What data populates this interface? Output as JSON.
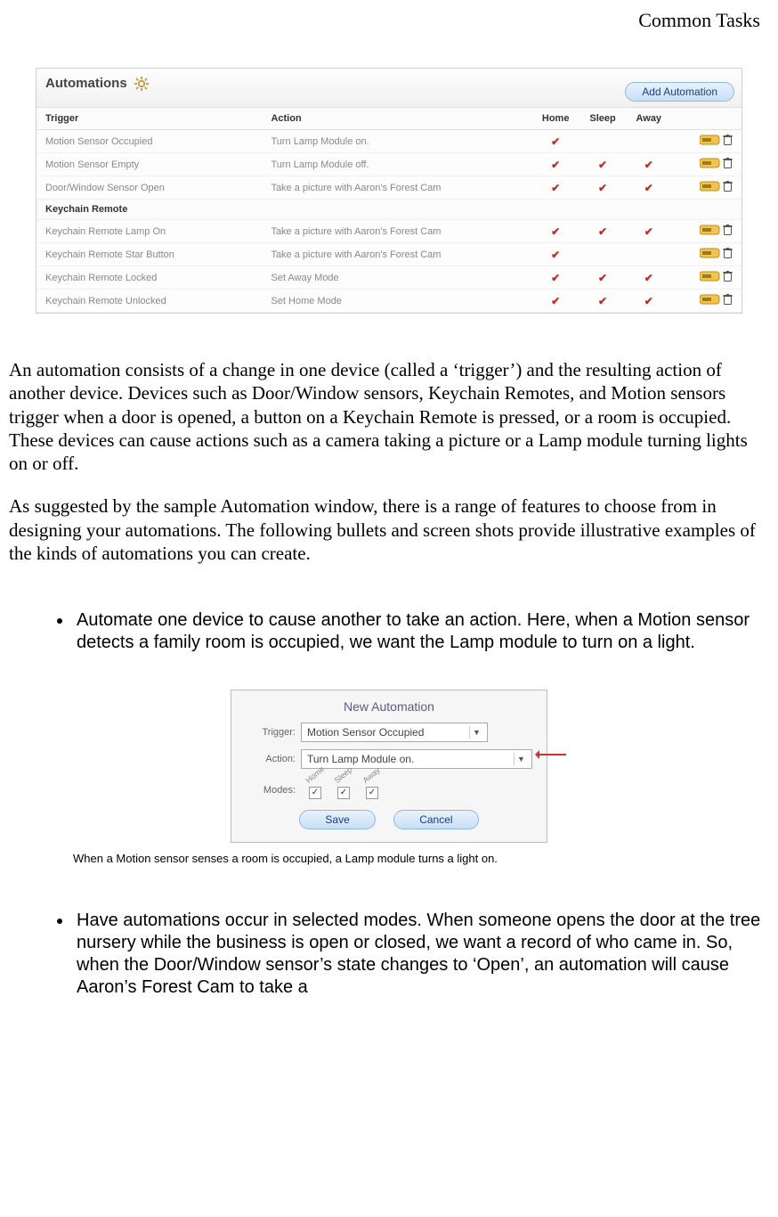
{
  "header": {
    "section_title": "Common Tasks"
  },
  "panel": {
    "title": "Automations",
    "add_button": "Add Automation",
    "columns": {
      "trigger": "Trigger",
      "action": "Action",
      "home": "Home",
      "sleep": "Sleep",
      "away": "Away"
    },
    "rows": [
      {
        "trigger": "Motion Sensor Occupied",
        "action": "Turn Lamp Module on.",
        "home": true,
        "sleep": false,
        "away": false
      },
      {
        "trigger": "Motion Sensor Empty",
        "action": "Turn Lamp Module off.",
        "home": true,
        "sleep": true,
        "away": true
      },
      {
        "trigger": "Door/Window Sensor Open",
        "action": "Take a picture with Aaron's Forest Cam",
        "home": true,
        "sleep": true,
        "away": true
      }
    ],
    "group_label": "Keychain Remote",
    "rows2": [
      {
        "trigger": "Keychain Remote Lamp On",
        "action": "Take a picture with Aaron's Forest Cam",
        "home": true,
        "sleep": true,
        "away": true
      },
      {
        "trigger": "Keychain Remote Star Button",
        "action": "Take a picture with Aaron's Forest Cam",
        "home": true,
        "sleep": false,
        "away": false
      },
      {
        "trigger": "Keychain Remote Locked",
        "action": "Set Away Mode",
        "home": true,
        "sleep": true,
        "away": true
      },
      {
        "trigger": "Keychain Remote Unlocked",
        "action": "Set Home Mode",
        "home": true,
        "sleep": true,
        "away": true
      }
    ]
  },
  "paragraphs": {
    "p1": "An automation consists of a change in one device (called a ‘trigger’) and the resulting action of another device. Devices such as Door/Window sensors, Keychain Remotes, and Motion sensors trigger when a door is opened, a button on a Keychain Remote is pressed, or a room is occupied. These devices can cause actions such as a camera taking a picture or a Lamp module turning lights on or off.",
    "p2": "As suggested by the sample Automation window, there is a range of features to choose from in designing your automations. The following bullets and screen shots provide illustrative examples of the kinds of automations you can create."
  },
  "bullets": {
    "b1": "Automate one device to cause another to take an action. Here, when a Motion sensor detects a family room is occupied, we want the Lamp module to turn on a light.",
    "b2": "Have automations occur in selected modes. When someone opens the door at the tree nursery while the business is open or closed, we want a record of who came in. So, when the Door/Window sensor’s state changes to ‘Open’, an automation will cause Aaron’s Forest Cam to take a"
  },
  "dialog": {
    "title": "New Automation",
    "labels": {
      "trigger": "Trigger:",
      "action": "Action:",
      "modes": "Modes:"
    },
    "trigger_value": "Motion Sensor Occupied",
    "action_value": "Turn Lamp Module on.",
    "mode_labels": {
      "home": "Home",
      "sleep": "Sleep",
      "away": "Away"
    },
    "mode_checks": {
      "home": "✓",
      "sleep": "✓",
      "away": "✓"
    },
    "save": "Save",
    "cancel": "Cancel"
  },
  "caption": "When a Motion sensor senses a room is occupied, a Lamp module turns a light on."
}
